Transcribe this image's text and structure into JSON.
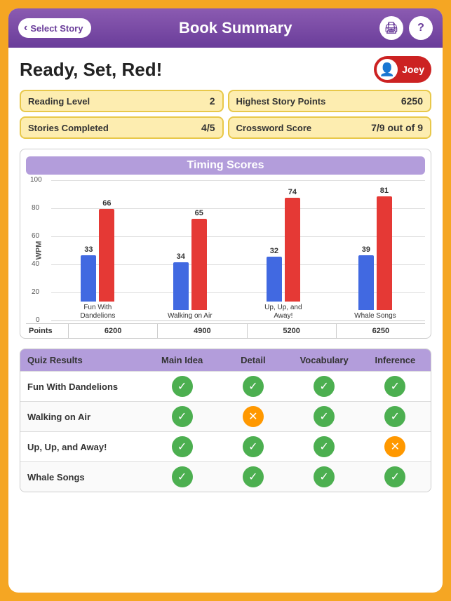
{
  "header": {
    "back_label": "Select Story",
    "title": "Book Summary",
    "print_icon": "🖨",
    "help_icon": "?"
  },
  "book": {
    "title": "Ready, Set, Red!",
    "user": {
      "name": "Joey",
      "avatar": "👤"
    }
  },
  "stats": [
    {
      "label": "Reading Level",
      "value": "2"
    },
    {
      "label": "Highest Story Points",
      "value": "6250"
    },
    {
      "label": "Stories Completed",
      "value": "4/5"
    },
    {
      "label": "Crossword Score",
      "value": "7/9 out of 9"
    }
  ],
  "chart": {
    "title": "Timing Scores",
    "y_label": "WPM",
    "y_ticks": [
      100,
      80,
      60,
      40,
      20,
      0
    ],
    "bars": [
      {
        "label": "Fun With\nDandelions",
        "blue": 33,
        "red": 66,
        "points": "6200"
      },
      {
        "label": "Walking on Air",
        "blue": 34,
        "red": 65,
        "points": "4900"
      },
      {
        "label": "Up, Up, and\nAway!",
        "blue": 32,
        "red": 74,
        "points": "5200"
      },
      {
        "label": "Whale Songs",
        "blue": 39,
        "red": 81,
        "points": "6250"
      }
    ],
    "points_label": "Points"
  },
  "quiz": {
    "title": "Quiz Results",
    "columns": [
      "Main Idea",
      "Detail",
      "Vocabulary",
      "Inference"
    ],
    "rows": [
      {
        "story": "Fun With Dandelions",
        "results": [
          "green",
          "green",
          "green",
          "green"
        ]
      },
      {
        "story": "Walking on Air",
        "results": [
          "green",
          "orange",
          "green",
          "green"
        ]
      },
      {
        "story": "Up, Up, and Away!",
        "results": [
          "green",
          "green",
          "green",
          "orange"
        ]
      },
      {
        "story": "Whale Songs",
        "results": [
          "green",
          "green",
          "green",
          "green"
        ]
      }
    ]
  }
}
